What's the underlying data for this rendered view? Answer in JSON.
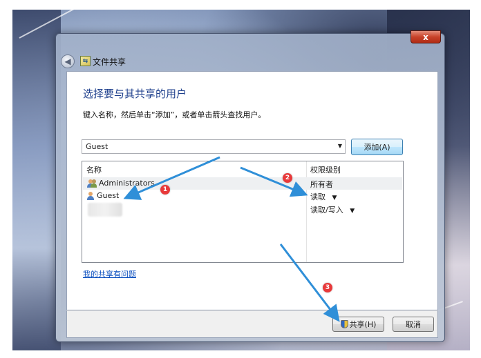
{
  "window": {
    "title": "文件共享",
    "close_glyph": "x"
  },
  "dialog": {
    "heading": "选择要与其共享的用户",
    "instruction": "键入名称，然后单击“添加”，或者单击箭头查找用户。",
    "name_input_value": "Guest",
    "add_button": "添加(A)",
    "help_link": "我的共享有问题"
  },
  "list": {
    "columns": [
      "名称",
      "权限级别"
    ],
    "rows": [
      {
        "name": "Administrators",
        "permission": "所有者",
        "icon": "group-icon",
        "selected": true
      },
      {
        "name": "Guest",
        "permission": "读取",
        "icon": "user-icon",
        "has_dropdown": true
      },
      {
        "name": "",
        "permission": "读取/写入",
        "icon": "blurred-user",
        "has_dropdown": true
      }
    ],
    "dropdown_glyph": "▼"
  },
  "footer": {
    "share_button": "共享(H)",
    "cancel_button": "取消"
  },
  "annotations": {
    "markers": [
      "1",
      "2",
      "3"
    ],
    "color": "#e8393a",
    "arrow_color": "#2f8fd8"
  }
}
